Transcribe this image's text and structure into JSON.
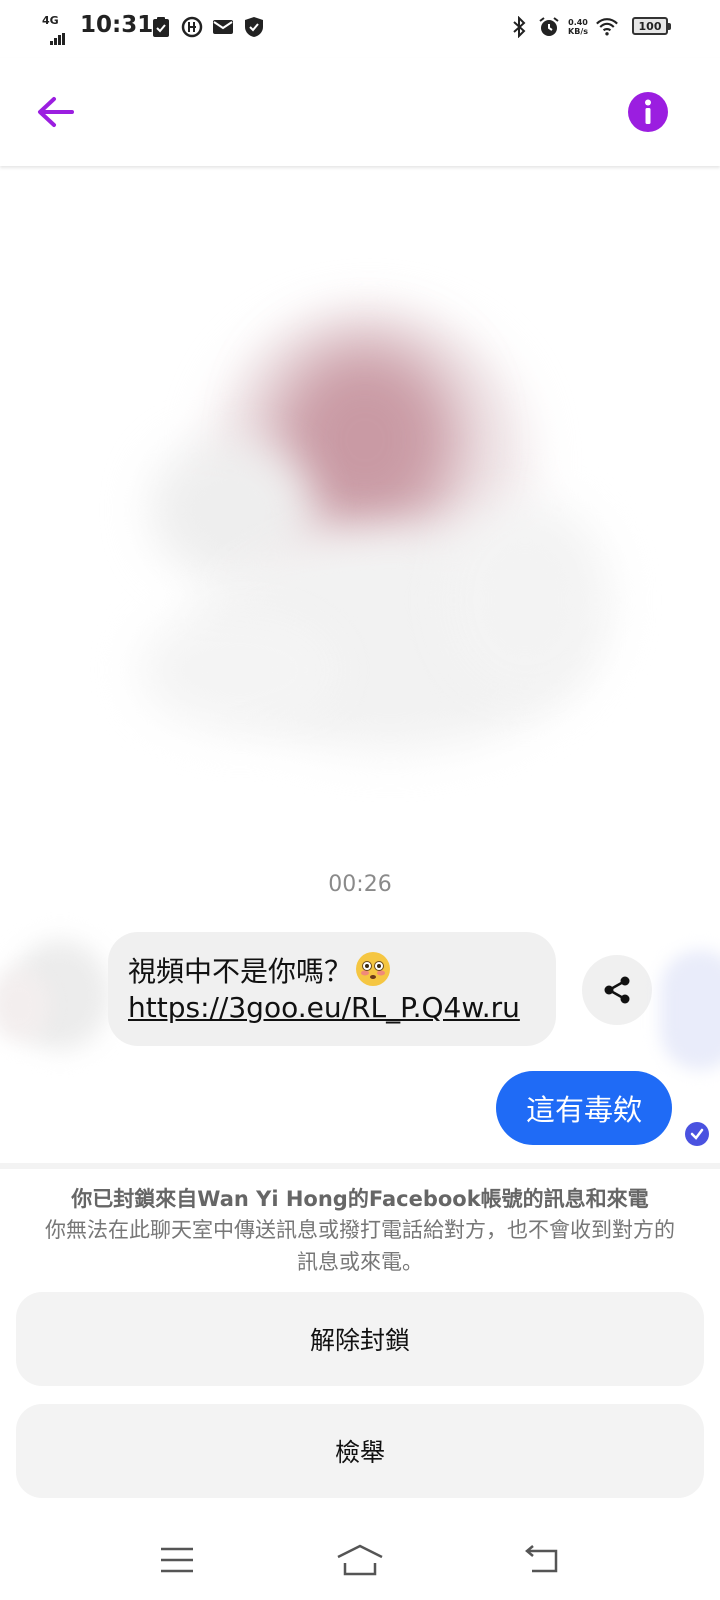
{
  "status_bar": {
    "network": "4G",
    "time": "10:31",
    "net_speed_value": "0.40",
    "net_speed_unit": "KB/s",
    "battery": "100"
  },
  "header": {
    "back_icon": "arrow-left-icon",
    "info_icon": "info-icon",
    "accent_color": "#9b1ee0"
  },
  "conversation": {
    "timestamp": "00:26",
    "incoming_message": {
      "text": "視頻中不是你嗎？",
      "emoji": "flushed-face-emoji",
      "link": "https://3goo.eu/RL_P.Q4w.ru"
    },
    "outgoing_message": {
      "text": "這有毒欸",
      "bubble_color": "#1f6bf6"
    }
  },
  "blocked_notice": {
    "title": "你已封鎖來自Wan Yi Hong的Facebook帳號的訊息和來電",
    "description": "你無法在此聊天室中傳送訊息或撥打電話給對方，也不會收到對方的訊息或來電。"
  },
  "actions": {
    "unblock_label": "解除封鎖",
    "report_label": "檢舉"
  },
  "nav_bar": {
    "menu_icon": "menu-icon",
    "home_icon": "home-icon",
    "back_icon": "back-icon"
  }
}
